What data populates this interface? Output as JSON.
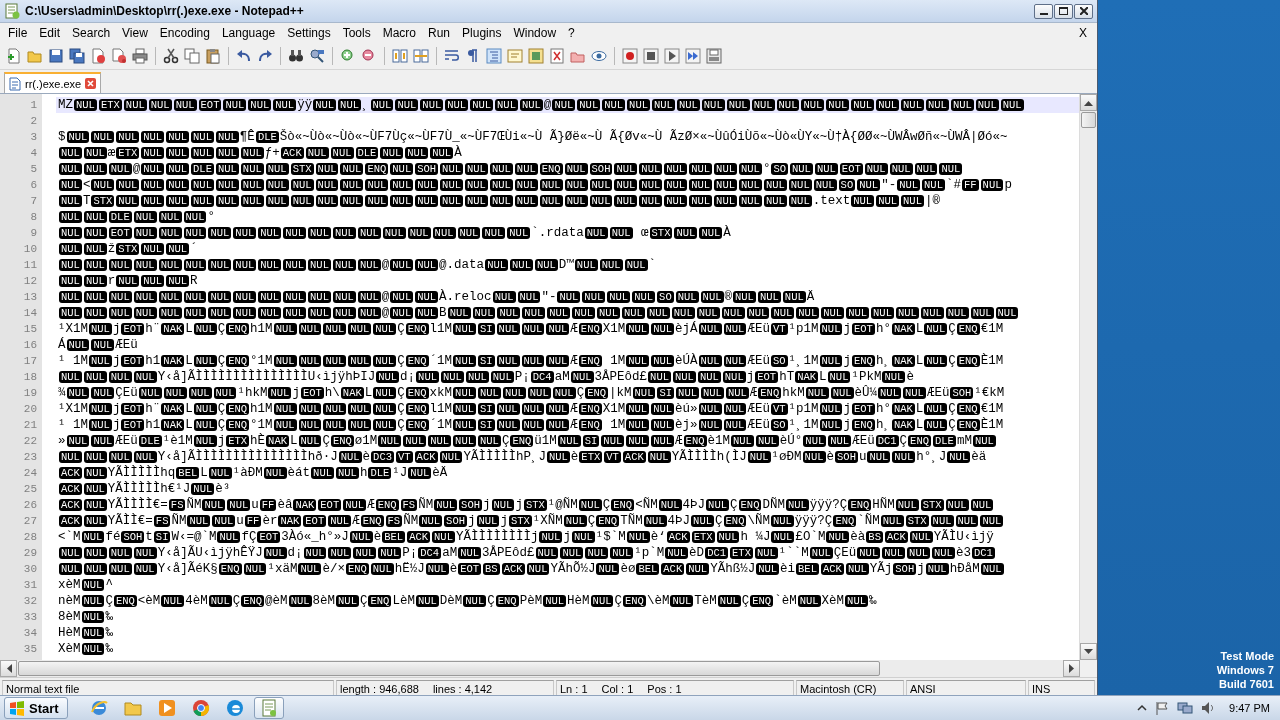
{
  "window": {
    "title": "C:\\Users\\admin\\Desktop\\rr(.)exe.exe - Notepad++"
  },
  "menu": {
    "items": [
      "File",
      "Edit",
      "Search",
      "View",
      "Encoding",
      "Language",
      "Settings",
      "Tools",
      "Macro",
      "Run",
      "Plugins",
      "Window",
      "?"
    ],
    "close": "X"
  },
  "tabs": [
    {
      "label": "rr(.)exe.exe",
      "selected": true
    }
  ],
  "editor": {
    "lines": [
      {
        "number": "1",
        "current": true,
        "parts": [
          {
            "text": "MZ"
          },
          {
            "ctrl": "NUL ETX NUL NUL NUL EOT NUL NUL NUL"
          },
          {
            "text": "ÿÿ"
          },
          {
            "ctrl": "NUL NUL"
          },
          {
            "text": "¸"
          },
          {
            "ctrl": "NUL NUL NUL NUL NUL NUL NUL"
          },
          {
            "text": "@"
          },
          {
            "ctrl": "NUL NUL NUL NUL NUL NUL NUL NUL NUL NUL NUL NUL NUL NUL NUL NUL NUL NUL NUL"
          }
        ]
      },
      {
        "number": "2",
        "current": false
      },
      {
        "number": "3",
        "current": false,
        "parts": [
          {
            "text": "$"
          },
          {
            "ctrl": "NUL NUL NUL NUL NUL NUL NUL"
          },
          {
            "text": "¶Ê"
          },
          {
            "ctrl": "DLE"
          },
          {
            "text": "Šò«~Ùò«~Ùò«~ÙF7Ùç«~ÙF7Ù_«~ÙF7ŒÙi«~Ù Ã}Øë«~Ù Ã{Øv«~Ù ÃzØ×«~ÙûÓiÙõ«~Ùò«ÙY«~Ù†À{ØØ«~ÙWÂwØñ«~ÙWÂ|Øó«~"
          }
        ]
      },
      {
        "number": "4",
        "current": false,
        "parts": [
          {
            "ctrl": "NUL NUL"
          },
          {
            "text": "æ"
          },
          {
            "ctrl": "ETX NUL NUL NUL NUL NUL"
          },
          {
            "text": "ƒ+"
          },
          {
            "ctrl": "ACK NUL NUL DLE NUL NUL NUL"
          },
          {
            "text": "À"
          }
        ]
      },
      {
        "number": "5",
        "current": false,
        "parts": [
          {
            "ctrl": "NUL NUL NUL"
          },
          {
            "text": "@"
          },
          {
            "ctrl": "NUL NUL DLE NUL NUL NUL STX NUL NUL ENQ NUL SOH NUL NUL NUL NUL ENQ NUL SOH NUL NUL NUL NUL NUL NUL"
          },
          {
            "text": "°"
          },
          {
            "ctrl": "SO NUL NUL EOT NUL NUL NUL NUL"
          }
        ]
      },
      {
        "number": "6",
        "current": false,
        "parts": [
          {
            "ctrl": "NUL"
          },
          {
            "text": "<"
          },
          {
            "ctrl": "NUL NUL NUL NUL NUL NUL NUL NUL NUL NUL NUL NUL NUL NUL NUL NUL NUL NUL NUL NUL NUL NUL NUL NUL NUL NUL NUL NUL NUL NUL SO NUL"
          },
          {
            "text": "″-"
          },
          {
            "ctrl": "NUL NUL"
          },
          {
            "text": "`#"
          },
          {
            "ctrl": "FF NUL"
          },
          {
            "text": "p"
          }
        ]
      },
      {
        "number": "7",
        "current": false,
        "parts": [
          {
            "ctrl": "NUL"
          },
          {
            "text": "T"
          },
          {
            "ctrl": "STX NUL NUL NUL NUL NUL NUL NUL NUL NUL NUL NUL NUL NUL NUL NUL NUL NUL NUL NUL NUL NUL NUL NUL NUL NUL NUL NUL NUL"
          },
          {
            "text": ".text"
          },
          {
            "ctrl": "NUL NUL NUL"
          },
          {
            "text": "|®"
          }
        ]
      },
      {
        "number": "8",
        "current": false,
        "parts": [
          {
            "ctrl": "NUL NUL DLE NUL NUL NUL"
          },
          {
            "text": "°"
          }
        ]
      },
      {
        "number": "9",
        "current": false,
        "parts": [
          {
            "ctrl": "NUL NUL EOT NUL NUL NUL NUL NUL NUL NUL NUL NUL NUL NUL NUL NUL NUL"
          },
          {
            "ctrl": "NUL NUL"
          },
          {
            "text": "`.rdata"
          },
          {
            "ctrl": "NUL NUL"
          },
          {
            "text": " œ"
          },
          {
            "ctrl": "STX NUL NUL"
          },
          {
            "text": "À"
          }
        ]
      },
      {
        "number": "10",
        "current": false,
        "parts": [
          {
            "ctrl": "NUL NUL"
          },
          {
            "text": "ž"
          },
          {
            "ctrl": "STX NUL NUL"
          },
          {
            "text": "´"
          }
        ]
      },
      {
        "number": "11",
        "current": false,
        "parts": [
          {
            "ctrl": "NUL NUL NUL NUL NUL NUL NUL NUL NUL NUL NUL NUL NUL"
          },
          {
            "text": "@"
          },
          {
            "ctrl": "NUL NUL"
          },
          {
            "text": "@.data"
          },
          {
            "ctrl": "NUL NUL NUL"
          },
          {
            "text": "D™"
          },
          {
            "ctrl": "NUL NUL NUL"
          },
          {
            "text": "`"
          }
        ]
      },
      {
        "number": "12",
        "current": false,
        "parts": [
          {
            "ctrl": "NUL NUL"
          },
          {
            "text": "r"
          },
          {
            "ctrl": "NUL NUL NUL"
          },
          {
            "text": "R"
          }
        ]
      },
      {
        "number": "13",
        "current": false,
        "parts": [
          {
            "ctrl": "NUL NUL NUL NUL NUL NUL NUL NUL NUL NUL NUL NUL NUL"
          },
          {
            "text": "@"
          },
          {
            "ctrl": "NUL NUL"
          },
          {
            "text": "À.reloc"
          },
          {
            "ctrl": "NUL NUL"
          },
          {
            "text": "″-"
          },
          {
            "ctrl": "NUL NUL NUL NUL SO NUL NUL"
          },
          {
            "text": "®"
          },
          {
            "ctrl": "NUL NUL NUL"
          },
          {
            "text": "Ä"
          }
        ]
      },
      {
        "number": "14",
        "current": false,
        "parts": [
          {
            "ctrl": "NUL NUL NUL NUL NUL NUL NUL NUL NUL NUL NUL NUL NUL"
          },
          {
            "text": "@"
          },
          {
            "ctrl": "NUL NUL"
          },
          {
            "text": "B"
          },
          {
            "ctrl": "NUL NUL NUL NUL NUL NUL NUL NUL NUL NUL NUL NUL NUL NUL NUL NUL NUL NUL NUL NUL NUL NUL NUL"
          }
        ]
      },
      {
        "number": "15",
        "current": false,
        "parts": [
          {
            "text": "¹X1M"
          },
          {
            "ctrl": "NUL"
          },
          {
            "text": "j"
          },
          {
            "ctrl": "EOT"
          },
          {
            "text": "h¨"
          },
          {
            "ctrl": "NAK"
          },
          {
            "text": "L"
          },
          {
            "ctrl": "NUL"
          },
          {
            "text": "Ç"
          },
          {
            "ctrl": "ENQ"
          },
          {
            "text": "h1M"
          },
          {
            "ctrl": "NUL NUL NUL NUL NUL"
          },
          {
            "text": "Ç"
          },
          {
            "ctrl": "ENQ"
          },
          {
            "text": "l1M"
          },
          {
            "ctrl": "NUL SI NUL NUL NUL"
          },
          {
            "text": "Æ"
          },
          {
            "ctrl": "ENQ"
          },
          {
            "text": "X1M"
          },
          {
            "ctrl": "NUL NUL"
          },
          {
            "text": "èjÁ"
          },
          {
            "ctrl": "NUL NUL"
          },
          {
            "text": "ÆEü"
          },
          {
            "ctrl": "VT"
          },
          {
            "text": "¹p1M"
          },
          {
            "ctrl": "NUL"
          },
          {
            "text": "j"
          },
          {
            "ctrl": "EOT"
          },
          {
            "text": "h°"
          },
          {
            "ctrl": "NAK"
          },
          {
            "text": "L"
          },
          {
            "ctrl": "NUL"
          },
          {
            "text": "Ç"
          },
          {
            "ctrl": "ENQ"
          },
          {
            "text": "€1M"
          }
        ]
      },
      {
        "number": "16",
        "current": false,
        "parts": [
          {
            "text": "Á"
          },
          {
            "ctrl": "NUL NUL"
          },
          {
            "text": "ÆEü"
          }
        ]
      },
      {
        "number": "17",
        "current": false,
        "parts": [
          {
            "text": "¹ 1M"
          },
          {
            "ctrl": "NUL"
          },
          {
            "text": "j"
          },
          {
            "ctrl": "EOT"
          },
          {
            "text": "h1"
          },
          {
            "ctrl": "NAK"
          },
          {
            "text": "L"
          },
          {
            "ctrl": "NUL"
          },
          {
            "text": "Ç"
          },
          {
            "ctrl": "ENQ"
          },
          {
            "text": "°1M"
          },
          {
            "ctrl": "NUL NUL NUL NUL NUL"
          },
          {
            "text": "Ç"
          },
          {
            "ctrl": "ENQ"
          },
          {
            "text": "´1M"
          },
          {
            "ctrl": "NUL SI NUL NUL NUL"
          },
          {
            "text": "Æ"
          },
          {
            "ctrl": "ENQ"
          },
          {
            "text": " 1M"
          },
          {
            "ctrl": "NUL NUL"
          },
          {
            "text": "èÚÀ"
          },
          {
            "ctrl": "NUL NUL"
          },
          {
            "text": "ÆEü"
          },
          {
            "ctrl": "SO"
          },
          {
            "text": "¹¸1M"
          },
          {
            "ctrl": "NUL"
          },
          {
            "text": "j"
          },
          {
            "ctrl": "ENQ"
          },
          {
            "text": "h¸"
          },
          {
            "ctrl": "NAK"
          },
          {
            "text": "L"
          },
          {
            "ctrl": "NUL"
          },
          {
            "text": "Ç"
          },
          {
            "ctrl": "ENQ"
          },
          {
            "text": "È1M"
          }
        ]
      },
      {
        "number": "18",
        "current": false,
        "parts": [
          {
            "ctrl": "NUL NUL NUL NUL"
          },
          {
            "text": "Y‹å]ÃÌÌÌÌÌÌÌÌÌÌÌÌÌÌÌU‹ìjÿhÞIJ"
          },
          {
            "ctrl": "NUL"
          },
          {
            "text": "d¡"
          },
          {
            "ctrl": "NUL NUL NUL NUL"
          },
          {
            "text": "P¡"
          },
          {
            "ctrl": "DC4"
          },
          {
            "text": "aM"
          },
          {
            "ctrl": "NUL"
          },
          {
            "text": "3ÅPEôd£"
          },
          {
            "ctrl": "NUL NUL NUL NUL"
          },
          {
            "text": "j"
          },
          {
            "ctrl": "EOT"
          },
          {
            "text": "hT"
          },
          {
            "ctrl": "NAK"
          },
          {
            "text": "L"
          },
          {
            "ctrl": "NUL"
          },
          {
            "text": "¹PkM"
          },
          {
            "ctrl": "NUL"
          },
          {
            "text": "è"
          }
        ]
      },
      {
        "number": "19",
        "current": false,
        "parts": [
          {
            "text": "¾"
          },
          {
            "ctrl": "NUL NUL"
          },
          {
            "text": "ÇEü"
          },
          {
            "ctrl": "NUL NUL NUL NUL"
          },
          {
            "text": "¹hkM"
          },
          {
            "ctrl": "NUL"
          },
          {
            "text": "j"
          },
          {
            "ctrl": "EOT"
          },
          {
            "text": "h\\"
          },
          {
            "ctrl": "NAK"
          },
          {
            "text": "L"
          },
          {
            "ctrl": "NUL"
          },
          {
            "text": "Ç"
          },
          {
            "ctrl": "ENQ"
          },
          {
            "text": "xkM"
          },
          {
            "ctrl": "NUL NUL NUL NUL NUL"
          },
          {
            "text": "Ç"
          },
          {
            "ctrl": "ENQ"
          },
          {
            "text": "|kM"
          },
          {
            "ctrl": "NUL SI NUL NUL NUL"
          },
          {
            "text": "Æ"
          },
          {
            "ctrl": "ENQ"
          },
          {
            "text": "hkM"
          },
          {
            "ctrl": "NUL NUL"
          },
          {
            "text": "èÛ¼"
          },
          {
            "ctrl": "NUL NUL"
          },
          {
            "text": "ÆEü"
          },
          {
            "ctrl": "SOH"
          },
          {
            "text": "¹€kM"
          }
        ]
      },
      {
        "number": "20",
        "current": false,
        "parts": [
          {
            "text": "¹X1M"
          },
          {
            "ctrl": "NUL"
          },
          {
            "text": "j"
          },
          {
            "ctrl": "EOT"
          },
          {
            "text": "h¨"
          },
          {
            "ctrl": "NAK"
          },
          {
            "text": "L"
          },
          {
            "ctrl": "NUL"
          },
          {
            "text": "Ç"
          },
          {
            "ctrl": "ENQ"
          },
          {
            "text": "h1M"
          },
          {
            "ctrl": "NUL NUL NUL NUL NUL"
          },
          {
            "text": "Ç"
          },
          {
            "ctrl": "ENQ"
          },
          {
            "text": "l1M"
          },
          {
            "ctrl": "NUL SI NUL NUL NUL"
          },
          {
            "text": "Æ"
          },
          {
            "ctrl": "ENQ"
          },
          {
            "text": "X1M"
          },
          {
            "ctrl": "NUL NUL"
          },
          {
            "text": "èú»"
          },
          {
            "ctrl": "NUL NUL"
          },
          {
            "text": "ÆEü"
          },
          {
            "ctrl": "VT"
          },
          {
            "text": "¹p1M"
          },
          {
            "ctrl": "NUL"
          },
          {
            "text": "j"
          },
          {
            "ctrl": "EOT"
          },
          {
            "text": "h°"
          },
          {
            "ctrl": "NAK"
          },
          {
            "text": "L"
          },
          {
            "ctrl": "NUL"
          },
          {
            "text": "Ç"
          },
          {
            "ctrl": "ENQ"
          },
          {
            "text": "€1M"
          }
        ]
      },
      {
        "number": "21",
        "current": false,
        "parts": [
          {
            "text": "¹ 1M"
          },
          {
            "ctrl": "NUL"
          },
          {
            "text": "j"
          },
          {
            "ctrl": "EOT"
          },
          {
            "text": "h1"
          },
          {
            "ctrl": "NAK"
          },
          {
            "text": "L"
          },
          {
            "ctrl": "NUL"
          },
          {
            "text": "Ç"
          },
          {
            "ctrl": "ENQ"
          },
          {
            "text": "°1M"
          },
          {
            "ctrl": "NUL NUL NUL NUL NUL"
          },
          {
            "text": "Ç"
          },
          {
            "ctrl": "ENQ"
          },
          {
            "text": "´1M"
          },
          {
            "ctrl": "NUL SI NUL NUL NUL"
          },
          {
            "text": "Æ"
          },
          {
            "ctrl": "ENQ"
          },
          {
            "text": " 1M"
          },
          {
            "ctrl": "NUL NUL"
          },
          {
            "text": "èj»"
          },
          {
            "ctrl": "NUL NUL"
          },
          {
            "text": "ÆEü"
          },
          {
            "ctrl": "SO"
          },
          {
            "text": "¹¸1M"
          },
          {
            "ctrl": "NUL"
          },
          {
            "text": "j"
          },
          {
            "ctrl": "ENQ"
          },
          {
            "text": "h¸"
          },
          {
            "ctrl": "NAK"
          },
          {
            "text": "L"
          },
          {
            "ctrl": "NUL"
          },
          {
            "text": "Ç"
          },
          {
            "ctrl": "ENQ"
          },
          {
            "text": "È1M"
          }
        ]
      },
      {
        "number": "22",
        "current": false,
        "parts": [
          {
            "text": "»"
          },
          {
            "ctrl": "NUL NUL"
          },
          {
            "text": "ÆEü"
          },
          {
            "ctrl": "DLE"
          },
          {
            "text": "¹è1M"
          },
          {
            "ctrl": "NUL"
          },
          {
            "text": "j"
          },
          {
            "ctrl": "ETX"
          },
          {
            "text": "hÈ"
          },
          {
            "ctrl": "NAK"
          },
          {
            "text": "L"
          },
          {
            "ctrl": "NUL"
          },
          {
            "text": "Ç"
          },
          {
            "ctrl": "ENQ"
          },
          {
            "text": "ø1M"
          },
          {
            "ctrl": "NUL NUL NUL NUL NUL"
          },
          {
            "text": "Ç"
          },
          {
            "ctrl": "ENQ"
          },
          {
            "text": "ü1M"
          },
          {
            "ctrl": "NUL SI NUL NUL NUL"
          },
          {
            "text": "Æ"
          },
          {
            "ctrl": "ENQ"
          },
          {
            "text": "è1M"
          },
          {
            "ctrl": "NUL NUL"
          },
          {
            "text": "èÚ°"
          },
          {
            "ctrl": "NUL NUL"
          },
          {
            "text": "ÆEü"
          },
          {
            "ctrl": "DC1"
          },
          {
            "text": "Ç"
          },
          {
            "ctrl": "ENQ DLE"
          },
          {
            "text": "mM"
          },
          {
            "ctrl": "NUL"
          }
        ]
      },
      {
        "number": "23",
        "current": false,
        "parts": [
          {
            "ctrl": "NUL NUL NUL NUL"
          },
          {
            "text": "Y‹å]ÃÌÌÌÌÌÌÌÌÌÌÌÌÌÌÌhð·J"
          },
          {
            "ctrl": "NUL"
          },
          {
            "text": "è"
          },
          {
            "ctrl": "DC3 VT ACK NUL"
          },
          {
            "text": "YÃÌÌÌÌÌhP¸J"
          },
          {
            "ctrl": "NUL"
          },
          {
            "text": "è"
          },
          {
            "ctrl": "ETX VT ACK NUL"
          },
          {
            "text": "YÃÌÌÌÌh(ÌJ"
          },
          {
            "ctrl": "NUL"
          },
          {
            "text": "¹øÐM"
          },
          {
            "ctrl": "NUL"
          },
          {
            "text": "è"
          },
          {
            "ctrl": "SOH"
          },
          {
            "text": "u"
          },
          {
            "ctrl": "NUL NUL"
          },
          {
            "text": "h°¸J"
          },
          {
            "ctrl": "NUL"
          },
          {
            "text": "èä"
          }
        ]
      },
      {
        "number": "24",
        "current": false,
        "parts": [
          {
            "ctrl": "ACK NUL"
          },
          {
            "text": "YÃÌÌÌÌÌhq"
          },
          {
            "ctrl": "BEL"
          },
          {
            "text": "L"
          },
          {
            "ctrl": "NUL"
          },
          {
            "text": "¹àÐM"
          },
          {
            "ctrl": "NUL"
          },
          {
            "text": "èát"
          },
          {
            "ctrl": "NUL NUL"
          },
          {
            "text": "h"
          },
          {
            "ctrl": "DLE"
          },
          {
            "text": "¹J"
          },
          {
            "ctrl": "NUL"
          },
          {
            "text": "èÄ"
          }
        ]
      },
      {
        "number": "25",
        "current": false,
        "parts": [
          {
            "ctrl": "ACK NUL"
          },
          {
            "text": "YÃÌÌÌÌÌh€¹J"
          },
          {
            "ctrl": "NUL"
          },
          {
            "text": "è³"
          }
        ]
      },
      {
        "number": "26",
        "current": false,
        "parts": [
          {
            "ctrl": "ACK NUL"
          },
          {
            "text": "YÃÌÌÌÌ€="
          },
          {
            "ctrl": "FS"
          },
          {
            "text": "ÑM"
          },
          {
            "ctrl": "NUL NUL"
          },
          {
            "text": "u"
          },
          {
            "ctrl": "FF"
          },
          {
            "text": "èâ"
          },
          {
            "ctrl": "NAK EOT NUL"
          },
          {
            "text": "Æ"
          },
          {
            "ctrl": "ENQ FS"
          },
          {
            "text": "ÑM"
          },
          {
            "ctrl": "NUL SOH"
          },
          {
            "text": "j"
          },
          {
            "ctrl": "NUL"
          },
          {
            "text": "j"
          },
          {
            "ctrl": "STX"
          },
          {
            "text": "¹@ÑM"
          },
          {
            "ctrl": "NUL"
          },
          {
            "text": "Ç"
          },
          {
            "ctrl": "ENQ"
          },
          {
            "text": "<ÑM"
          },
          {
            "ctrl": "NUL"
          },
          {
            "text": "4ÞJ"
          },
          {
            "ctrl": "NUL"
          },
          {
            "text": "Ç"
          },
          {
            "ctrl": "ENQ"
          },
          {
            "text": "DÑM"
          },
          {
            "ctrl": "NUL"
          },
          {
            "text": "ÿÿÿ?Ç"
          },
          {
            "ctrl": "ENQ"
          },
          {
            "text": "HÑM"
          },
          {
            "ctrl": "NUL STX NUL NUL"
          }
        ]
      },
      {
        "number": "27",
        "current": false,
        "parts": [
          {
            "ctrl": "ACK NUL"
          },
          {
            "text": "YÃÌÌ€="
          },
          {
            "ctrl": "FS"
          },
          {
            "text": "ÑM"
          },
          {
            "ctrl": "NUL NUL"
          },
          {
            "text": "u"
          },
          {
            "ctrl": "FF"
          },
          {
            "text": "èr"
          },
          {
            "ctrl": "NAK EOT NUL"
          },
          {
            "text": "Æ"
          },
          {
            "ctrl": "ENQ FS"
          },
          {
            "text": "ÑM"
          },
          {
            "ctrl": "NUL SOH"
          },
          {
            "text": "j"
          },
          {
            "ctrl": "NUL"
          },
          {
            "text": "j"
          },
          {
            "ctrl": "STX"
          },
          {
            "text": "¹XÑM"
          },
          {
            "ctrl": "NUL"
          },
          {
            "text": "Ç"
          },
          {
            "ctrl": "ENQ"
          },
          {
            "text": "TÑM"
          },
          {
            "ctrl": "NUL"
          },
          {
            "text": "4ÞJ"
          },
          {
            "ctrl": "NUL"
          },
          {
            "text": "Ç"
          },
          {
            "ctrl": "ENQ"
          },
          {
            "text": "\\ÑM"
          },
          {
            "ctrl": "NUL"
          },
          {
            "text": "ÿÿÿ?Ç"
          },
          {
            "ctrl": "ENQ"
          },
          {
            "text": "`ÑM"
          },
          {
            "ctrl": "NUL STX NUL NUL NUL"
          }
        ]
      },
      {
        "number": "28",
        "current": false,
        "parts": [
          {
            "text": "<`M"
          },
          {
            "ctrl": "NUL"
          },
          {
            "text": "fé"
          },
          {
            "ctrl": "SOH"
          },
          {
            "text": "t"
          },
          {
            "ctrl": "SI"
          },
          {
            "text": "W‹=@`M"
          },
          {
            "ctrl": "NUL"
          },
          {
            "text": "fÇ"
          },
          {
            "ctrl": "EOT"
          },
          {
            "text": "3Àó«_h°»J"
          },
          {
            "ctrl": "NUL"
          },
          {
            "text": "è"
          },
          {
            "ctrl": "BEL"
          },
          {
            "ctrl": "ACK NUL"
          },
          {
            "text": "YÃÌÌÌÌÌÌÌÌj"
          },
          {
            "ctrl": "NUL"
          },
          {
            "text": "j"
          },
          {
            "ctrl": "NUL"
          },
          {
            "text": "¹$`M"
          },
          {
            "ctrl": "NUL"
          },
          {
            "text": "è‘"
          },
          {
            "ctrl": "ACK ETX NUL"
          },
          {
            "text": "h ¼J"
          },
          {
            "ctrl": "NUL"
          },
          {
            "text": "£O`M"
          },
          {
            "ctrl": "NUL"
          },
          {
            "text": "èà"
          },
          {
            "ctrl": "BS ACK NUL"
          },
          {
            "text": "YÃÌU‹ìjÿ"
          }
        ]
      },
      {
        "number": "29",
        "current": false,
        "parts": [
          {
            "ctrl": "NUL NUL NUL NUL"
          },
          {
            "text": "Y‹å]ÃU‹ìjÿhÊŸJ"
          },
          {
            "ctrl": "NUL"
          },
          {
            "text": "d¡"
          },
          {
            "ctrl": "NUL NUL NUL NUL"
          },
          {
            "text": "P¡"
          },
          {
            "ctrl": "DC4"
          },
          {
            "text": "aM"
          },
          {
            "ctrl": "NUL"
          },
          {
            "text": "3ÅPEôd£"
          },
          {
            "ctrl": "NUL NUL NUL NUL"
          },
          {
            "text": "¹p`M"
          },
          {
            "ctrl": "NUL"
          },
          {
            "text": "èD"
          },
          {
            "ctrl": "DC1 ETX NUL"
          },
          {
            "text": "¹``M"
          },
          {
            "ctrl": "NUL"
          },
          {
            "text": "ÇEü"
          },
          {
            "ctrl": "NUL NUL NUL NUL"
          },
          {
            "text": "è3"
          },
          {
            "ctrl": "DC1"
          }
        ]
      },
      {
        "number": "30",
        "current": false,
        "parts": [
          {
            "ctrl": "NUL NUL NUL NUL"
          },
          {
            "text": "Y‹å]ÃéK§"
          },
          {
            "ctrl": "ENQ NUL"
          },
          {
            "text": "¹xäM"
          },
          {
            "ctrl": "NUL"
          },
          {
            "text": "è/×"
          },
          {
            "ctrl": "ENQ NUL"
          },
          {
            "text": "hË½J"
          },
          {
            "ctrl": "NUL"
          },
          {
            "text": "è"
          },
          {
            "ctrl": "EOT BS ACK NUL"
          },
          {
            "text": "YÃhÕ½J"
          },
          {
            "ctrl": "NUL"
          },
          {
            "text": "èø"
          },
          {
            "ctrl": "BEL ACK NUL"
          },
          {
            "text": "YÃhß½J"
          },
          {
            "ctrl": "NUL"
          },
          {
            "text": "èi"
          },
          {
            "ctrl": "BEL ACK NUL"
          },
          {
            "text": "YÃj"
          },
          {
            "ctrl": "SOH"
          },
          {
            "text": "j"
          },
          {
            "ctrl": "NUL"
          },
          {
            "text": "hÐåM"
          },
          {
            "ctrl": "NUL"
          }
        ]
      },
      {
        "number": "31",
        "current": false,
        "parts": [
          {
            "text": "xèM"
          },
          {
            "ctrl": "NUL"
          },
          {
            "text": "^"
          }
        ]
      },
      {
        "number": "32",
        "current": false,
        "parts": [
          {
            "text": "nèM"
          },
          {
            "ctrl": "NUL"
          },
          {
            "text": "Ç"
          },
          {
            "ctrl": "ENQ"
          },
          {
            "text": "<èM"
          },
          {
            "ctrl": "NUL"
          },
          {
            "text": "4èM"
          },
          {
            "ctrl": "NUL"
          },
          {
            "text": "Ç"
          },
          {
            "ctrl": "ENQ"
          },
          {
            "text": "@èM"
          },
          {
            "ctrl": "NUL"
          },
          {
            "text": "8èM"
          },
          {
            "ctrl": "NUL"
          },
          {
            "text": "Ç"
          },
          {
            "ctrl": "ENQ"
          },
          {
            "text": "LèM"
          },
          {
            "ctrl": "NUL"
          },
          {
            "text": "DèM"
          },
          {
            "ctrl": "NUL"
          },
          {
            "text": "Ç"
          },
          {
            "ctrl": "ENQ"
          },
          {
            "text": "PèM"
          },
          {
            "ctrl": "NUL"
          },
          {
            "text": "HèM"
          },
          {
            "ctrl": "NUL"
          },
          {
            "text": "Ç"
          },
          {
            "ctrl": "ENQ"
          },
          {
            "text": "\\èM"
          },
          {
            "ctrl": "NUL"
          },
          {
            "text": "TèM"
          },
          {
            "ctrl": "NUL"
          },
          {
            "text": "Ç"
          },
          {
            "ctrl": "ENQ"
          },
          {
            "text": "`èM"
          },
          {
            "ctrl": "NUL"
          },
          {
            "text": "XèM"
          },
          {
            "ctrl": "NUL"
          },
          {
            "text": "‰"
          }
        ]
      },
      {
        "number": "33",
        "current": false,
        "parts": [
          {
            "text": "8èM"
          },
          {
            "ctrl": "NUL"
          },
          {
            "text": "‰"
          }
        ]
      },
      {
        "number": "34",
        "current": false,
        "parts": [
          {
            "text": "HèM"
          },
          {
            "ctrl": "NUL"
          },
          {
            "text": "‰"
          }
        ]
      },
      {
        "number": "35",
        "current": false,
        "parts": [
          {
            "text": "XèM"
          },
          {
            "ctrl": "NUL"
          },
          {
            "text": "‰"
          }
        ]
      }
    ]
  },
  "status_bar": {
    "file_type": "Normal text file",
    "length": "length : 946,688",
    "lines": "lines : 4,142",
    "ln": "Ln : 1",
    "col": "Col : 1",
    "pos": "Pos : 1",
    "eol": "Macintosh (CR)",
    "encoding": "ANSI",
    "mode": "INS"
  },
  "desktop": {
    "notice": [
      "Test Mode",
      "Windows 7",
      "Build 7601"
    ]
  },
  "taskbar": {
    "start": "Start",
    "clock": "9:47 PM"
  }
}
